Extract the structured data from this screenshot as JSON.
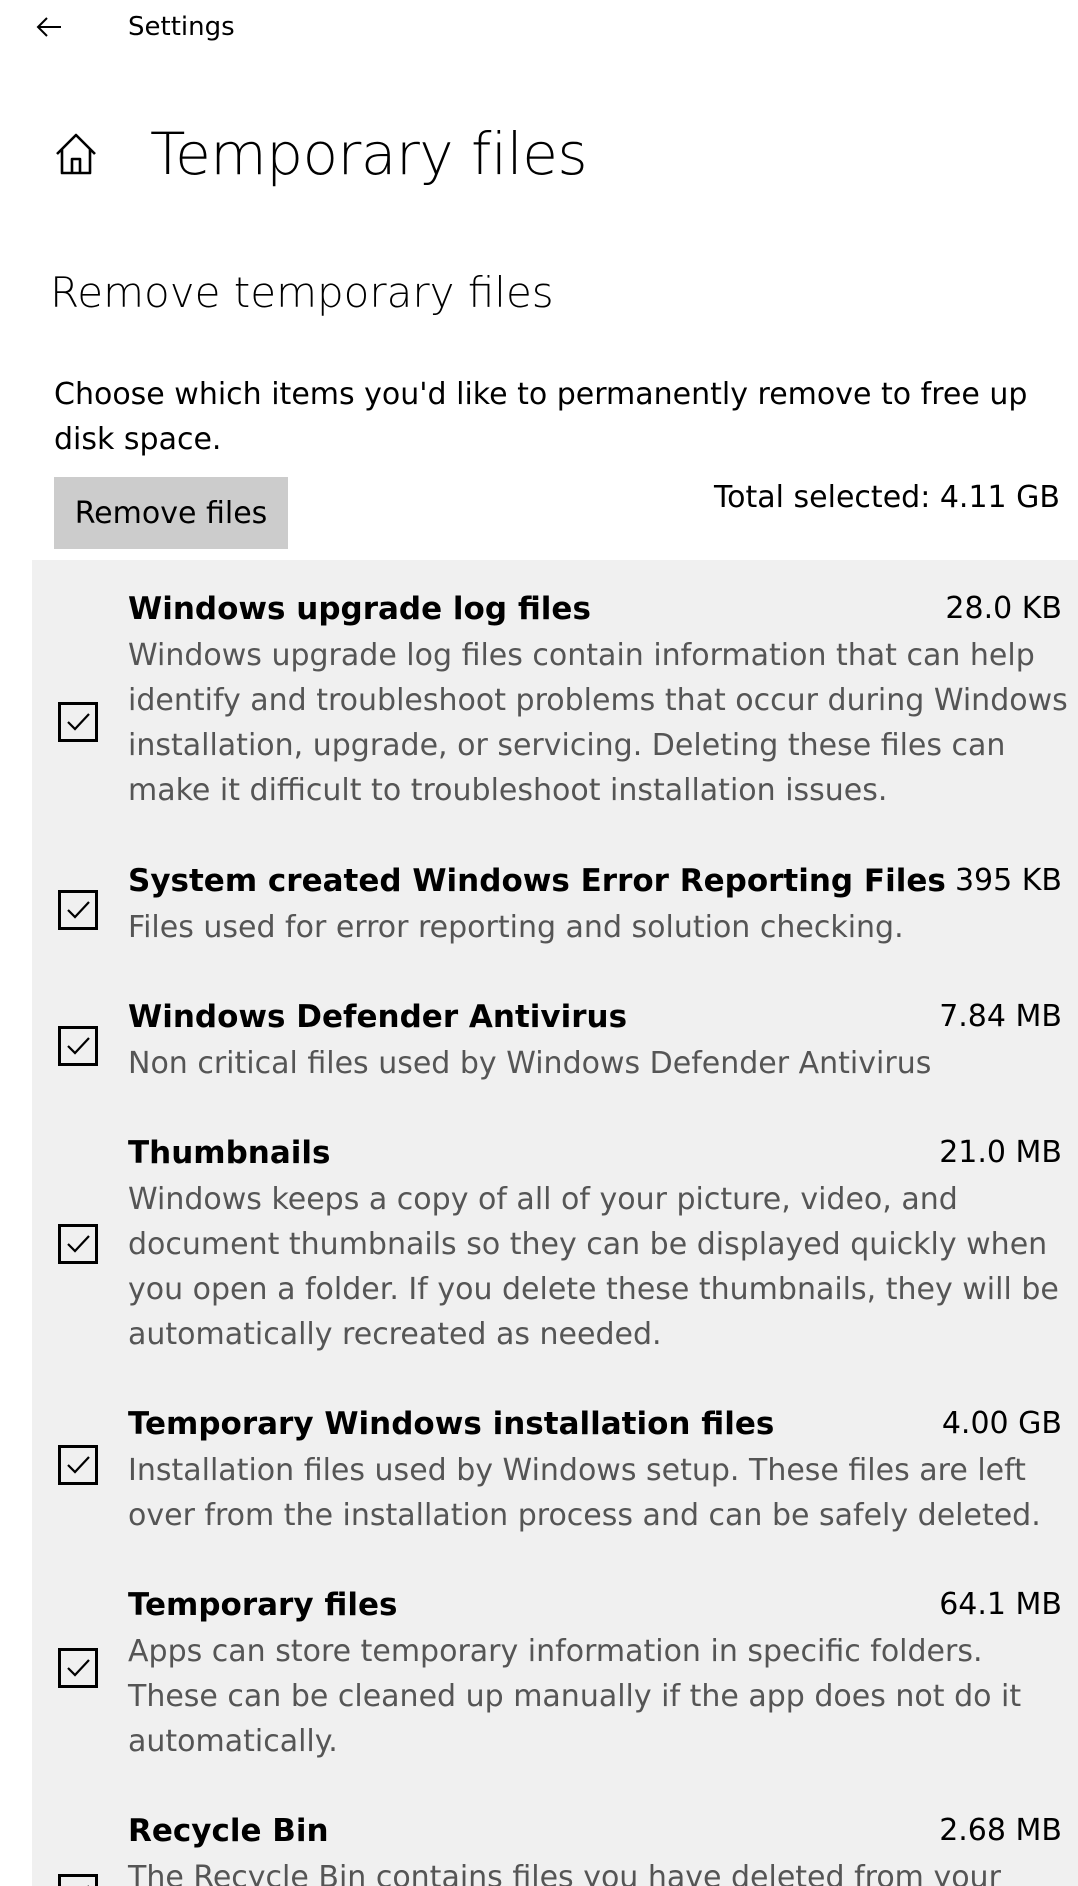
{
  "titlebar": {
    "title": "Settings"
  },
  "header": {
    "page_title": "Temporary files"
  },
  "section": {
    "title": "Remove temporary files",
    "description": "Choose which items you'd like to permanently remove to free up disk space.",
    "remove_button_label": "Remove files",
    "total_selected": "Total selected: 4.11 GB"
  },
  "items": [
    {
      "name": "Windows upgrade log files",
      "size": "28.0 KB",
      "description": "Windows upgrade log files contain information that can help identify and troubleshoot problems that occur during Windows installation, upgrade, or servicing.  Deleting these files can make it difficult to troubleshoot installation issues.",
      "checked": true
    },
    {
      "name": "System created Windows Error Reporting Files",
      "size": "395 KB",
      "description": "Files used for error reporting and solution checking.",
      "checked": true
    },
    {
      "name": "Windows Defender Antivirus",
      "size": "7.84 MB",
      "description": "Non critical files used by Windows Defender Antivirus",
      "checked": true
    },
    {
      "name": "Thumbnails",
      "size": "21.0 MB",
      "description": "Windows keeps a copy of all of your picture, video, and document thumbnails so they can be displayed quickly when you open a folder. If you delete these thumbnails, they will be automatically recreated as needed.",
      "checked": true
    },
    {
      "name": "Temporary Windows installation files",
      "size": "4.00 GB",
      "description": "Installation files used by Windows setup.  These files are left over from the installation process and can be safely deleted.",
      "checked": true
    },
    {
      "name": "Temporary files",
      "size": "64.1 MB",
      "description": "Apps can store temporary information in specific folders. These can be cleaned up manually if the app does not do it automatically.",
      "checked": true
    },
    {
      "name": "Recycle Bin",
      "size": "2.68 MB",
      "description": "The Recycle Bin contains files you have deleted from your",
      "checked": true
    }
  ],
  "icons": {
    "back": "back-arrow-icon",
    "home": "home-icon",
    "check": "checkmark-icon"
  }
}
